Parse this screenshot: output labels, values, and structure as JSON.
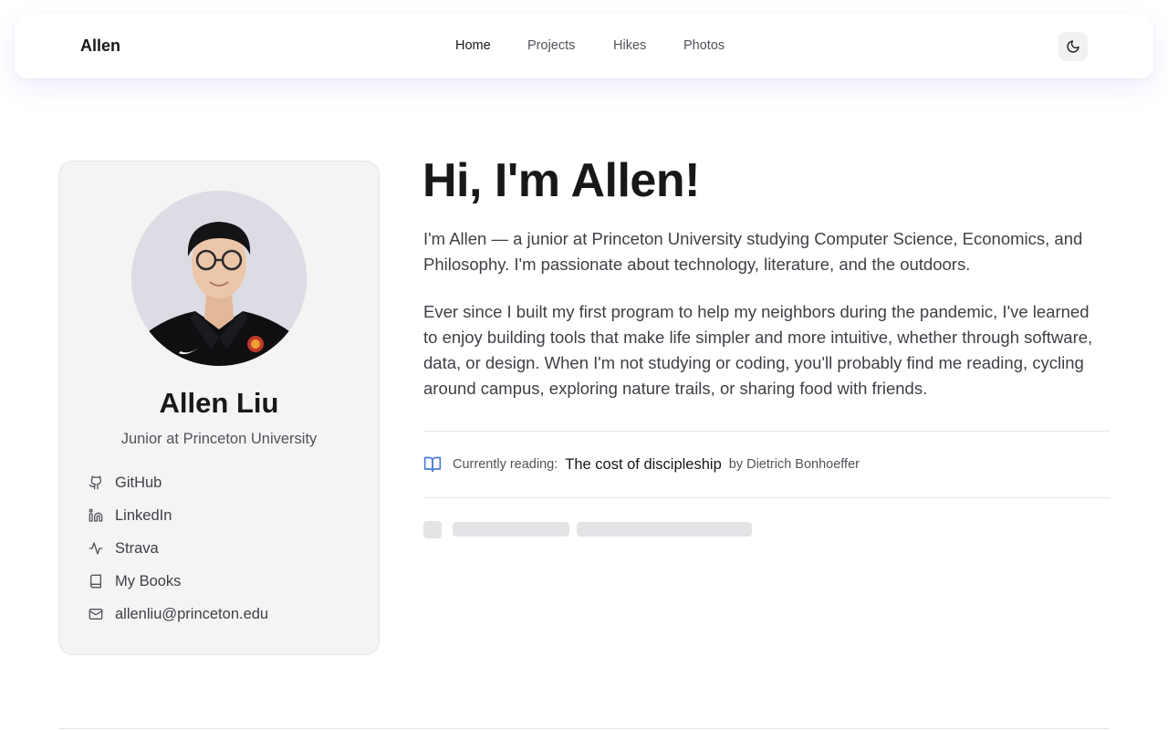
{
  "header": {
    "brand": "Allen",
    "nav": [
      {
        "label": "Home",
        "active": true
      },
      {
        "label": "Projects",
        "active": false
      },
      {
        "label": "Hikes",
        "active": false
      },
      {
        "label": "Photos",
        "active": false
      }
    ],
    "theme_toggle_icon": "moon-icon"
  },
  "profile": {
    "name": "Allen Liu",
    "title": "Junior at Princeton University",
    "links": [
      {
        "label": "GitHub",
        "icon": "github-icon"
      },
      {
        "label": "LinkedIn",
        "icon": "linkedin-icon"
      },
      {
        "label": "Strava",
        "icon": "activity-icon"
      },
      {
        "label": "My Books",
        "icon": "book-icon"
      },
      {
        "label": "allenliu@princeton.edu",
        "icon": "mail-icon"
      }
    ]
  },
  "main": {
    "heading": "Hi, I'm Allen!",
    "intro_lines": [
      "I'm Allen — a junior at Princeton University studying Computer Science, Economics, and",
      "Philosophy. I'm passionate about technology, literature, and the outdoors."
    ],
    "story_lines": [
      "Ever since I built my first program to help my neighbors during the pandemic, I've learned",
      "to enjoy building tools that make life simpler and more intuitive, whether through software,",
      "data, or design. When I'm not studying or coding, you'll probably find me reading, cycling",
      "around campus, exploring nature trails, or sharing food with friends."
    ],
    "reading": {
      "icon": "book-open-icon",
      "label": "Currently reading:",
      "title": "The cost of discipleship",
      "author": "by Dietrich Bonhoeffer"
    }
  },
  "colors": {
    "accent": "#4b7bd6",
    "card_bg": "#f4f4f5",
    "text": "#18181b",
    "muted": "#52525b"
  }
}
